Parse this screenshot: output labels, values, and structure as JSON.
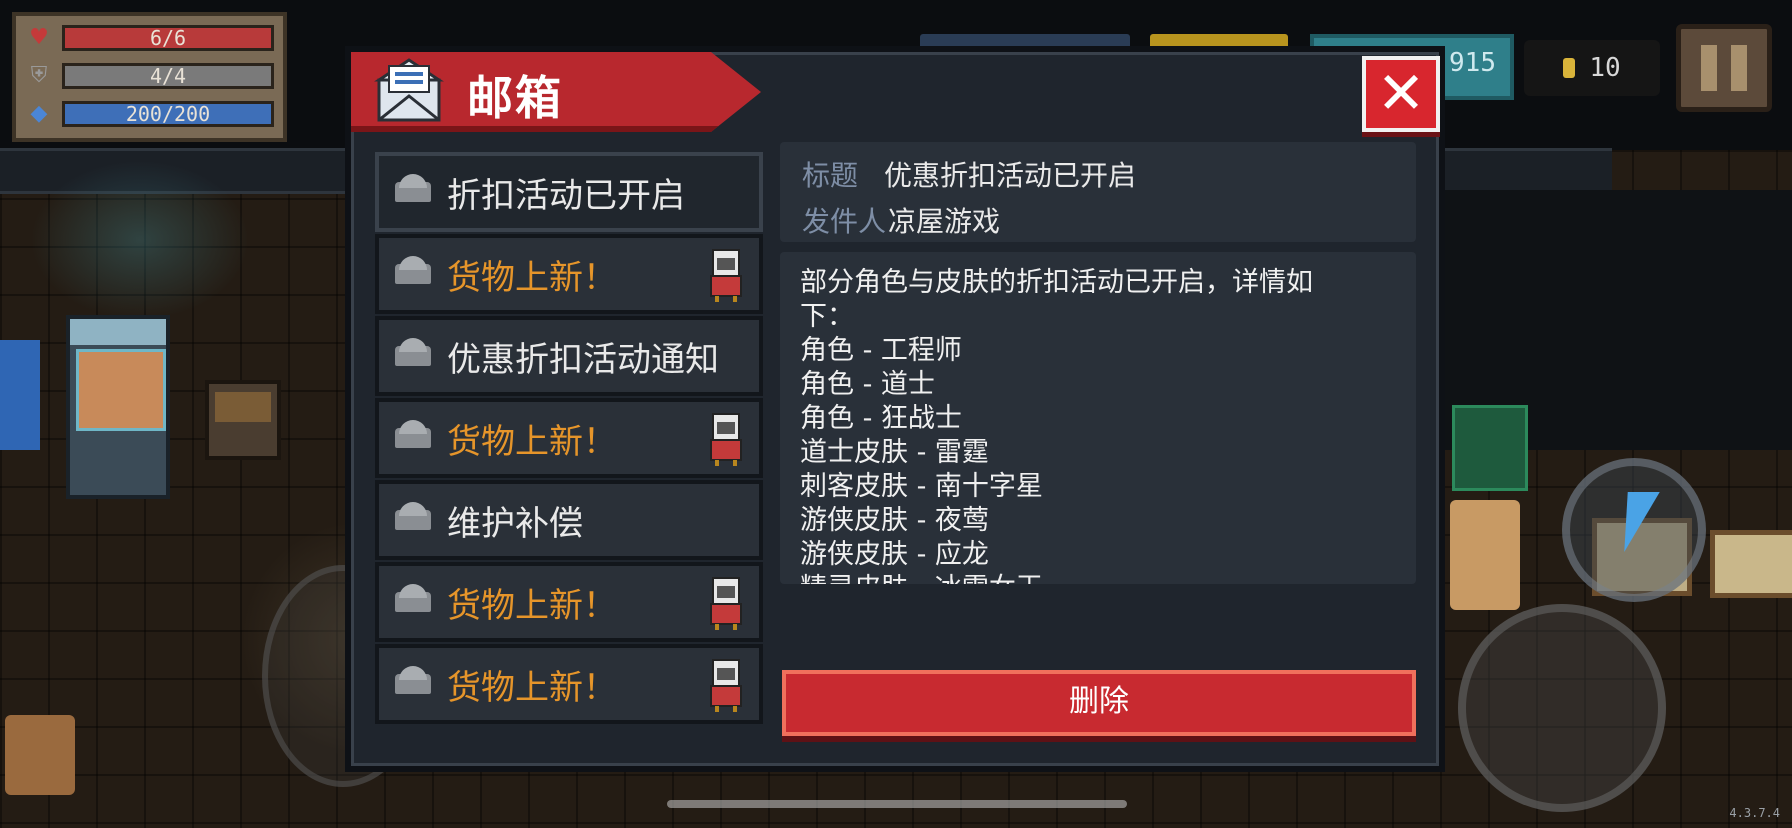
{
  "hud": {
    "hp": "6/6",
    "armor": "4/4",
    "energy": "200/200",
    "gems": "915",
    "coins": "10",
    "icons": {
      "hp": "heart-icon",
      "armor": "shield-icon",
      "energy": "diamond-icon",
      "coins": "coin-icon",
      "pause": "pause-icon"
    }
  },
  "mailbox": {
    "title": "邮箱",
    "close_label": "✕",
    "items": [
      {
        "label": "折扣活动已开启",
        "is_new": false,
        "has_gift": false,
        "selected": true
      },
      {
        "label": "货物上新！",
        "is_new": true,
        "has_gift": true,
        "selected": false
      },
      {
        "label": "优惠折扣活动通知",
        "is_new": false,
        "has_gift": false,
        "selected": false
      },
      {
        "label": "货物上新！",
        "is_new": true,
        "has_gift": true,
        "selected": false
      },
      {
        "label": "维护补偿",
        "is_new": false,
        "has_gift": false,
        "selected": false
      },
      {
        "label": "货物上新！",
        "is_new": true,
        "has_gift": true,
        "selected": false
      },
      {
        "label": "货物上新！",
        "is_new": true,
        "has_gift": true,
        "selected": false
      }
    ],
    "detail": {
      "title_label": "标题",
      "title_value": "优惠折扣活动已开启",
      "sender_label": "发件人",
      "sender_value": "凉屋游戏",
      "body": "部分角色与皮肤的折扣活动已开启，详情如\n下：\n角色 - 工程师\n角色 - 道士\n角色 - 狂战士\n道士皮肤 - 雷霆\n刺客皮肤 - 南十字星\n游侠皮肤 - 夜莺\n游侠皮肤 - 应龙\n精灵皮肤 - 冰雪女王\n骑士皮肤 - 电子骑士"
    },
    "delete_label": "删除"
  },
  "version": "4.3.7.4",
  "colors": {
    "header_red": "#b8282e",
    "new_item_orange": "#e6952a",
    "panel_bg": "#1f252d",
    "label_blue_gray": "#7e8ea6"
  }
}
